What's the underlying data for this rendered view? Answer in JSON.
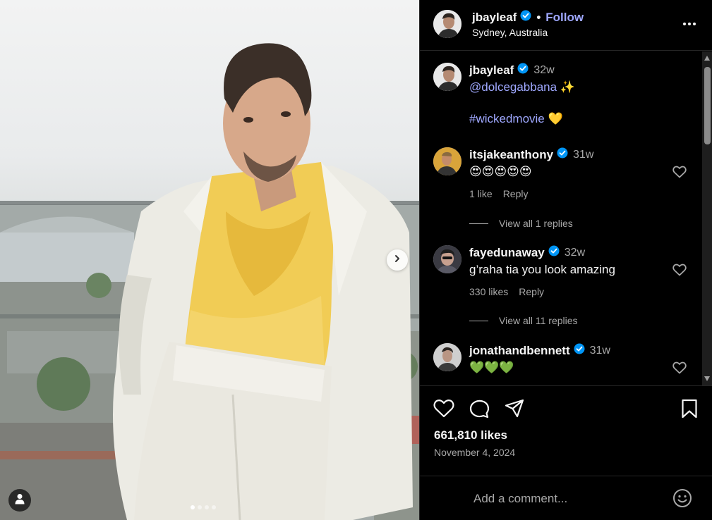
{
  "post": {
    "author": "jbayleaf",
    "location": "Sydney, Australia",
    "follow_label": "Follow",
    "separator": "•",
    "caption": {
      "mention": "@dolcegabbana",
      "mention_emoji": "✨",
      "hashtag": "#wickedmovie",
      "hashtag_emoji": "💛",
      "time": "32w"
    },
    "likes": "661,810 likes",
    "date": "November 4, 2024",
    "carousel": {
      "slide_count": 4,
      "active_index": 0
    }
  },
  "comments": [
    {
      "user": "itsjakeanthony",
      "time": "31w",
      "text": "😍😍😍😍😍",
      "likes": "1 like",
      "reply_label": "Reply",
      "view_replies": "View all 1 replies"
    },
    {
      "user": "fayedunaway",
      "time": "32w",
      "text": "g’raha tia you look amazing",
      "likes": "330 likes",
      "reply_label": "Reply",
      "view_replies": "View all 11 replies"
    },
    {
      "user": "jonathandbennett",
      "time": "31w",
      "text": "💚💚💚",
      "likes": "",
      "reply_label": "",
      "view_replies": ""
    }
  ],
  "composer": {
    "placeholder": "Add a comment..."
  },
  "icons": {
    "verified": "verified-badge-icon",
    "more": "more-options-icon",
    "like": "heart-icon",
    "comment": "comment-icon",
    "share": "share-icon",
    "save": "bookmark-icon",
    "emoji": "emoji-icon",
    "next": "chevron-right-icon",
    "tagged": "user-tag-icon"
  },
  "colors": {
    "link": "#9fa8ff",
    "verified": "#0095f6",
    "secondary_text": "#a8a8a8",
    "background": "#000000"
  }
}
